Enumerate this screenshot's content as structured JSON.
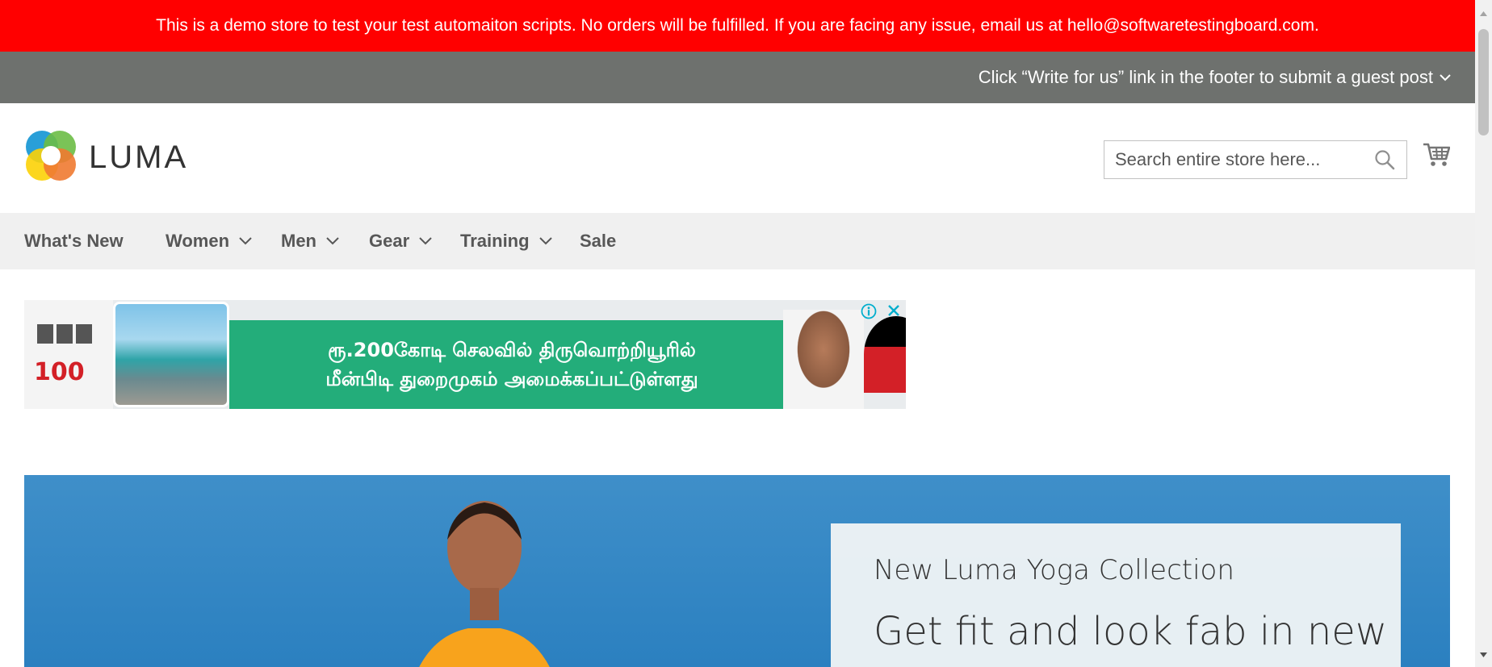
{
  "notice": {
    "demo_text": "This is a demo store to test your test automaiton scripts. No orders will be fulfilled. If you are facing any issue, email us at hello@softwaretestingboard.com.",
    "guest_post_text": "Click “Write for us” link in the footer to submit a guest post",
    "bg_color": "#ff0000",
    "guest_bg_color": "#6e716e"
  },
  "header": {
    "logo_text": "LUMA",
    "search_placeholder": "Search entire store here...",
    "search_value": "",
    "icons": [
      "luma-logo-icon",
      "search-icon",
      "cart-icon"
    ]
  },
  "nav": {
    "items": [
      {
        "label": "What's New",
        "has_dropdown": false
      },
      {
        "label": "Women",
        "has_dropdown": true
      },
      {
        "label": "Men",
        "has_dropdown": true
      },
      {
        "label": "Gear",
        "has_dropdown": true
      },
      {
        "label": "Training",
        "has_dropdown": true
      },
      {
        "label": "Sale",
        "has_dropdown": false
      }
    ]
  },
  "ad": {
    "line1": "ரூ.200கோடி செலவில் திருவொற்றியூரில்",
    "line2": "மீன்பிடி துறைமுகம் அமைக்கப்பட்டுள்ளது",
    "badge": "100",
    "accent_color": "#23ad7a"
  },
  "hero": {
    "subtitle": "New Luma Yoga Collection",
    "title": "Get fit and look fab in new"
  }
}
